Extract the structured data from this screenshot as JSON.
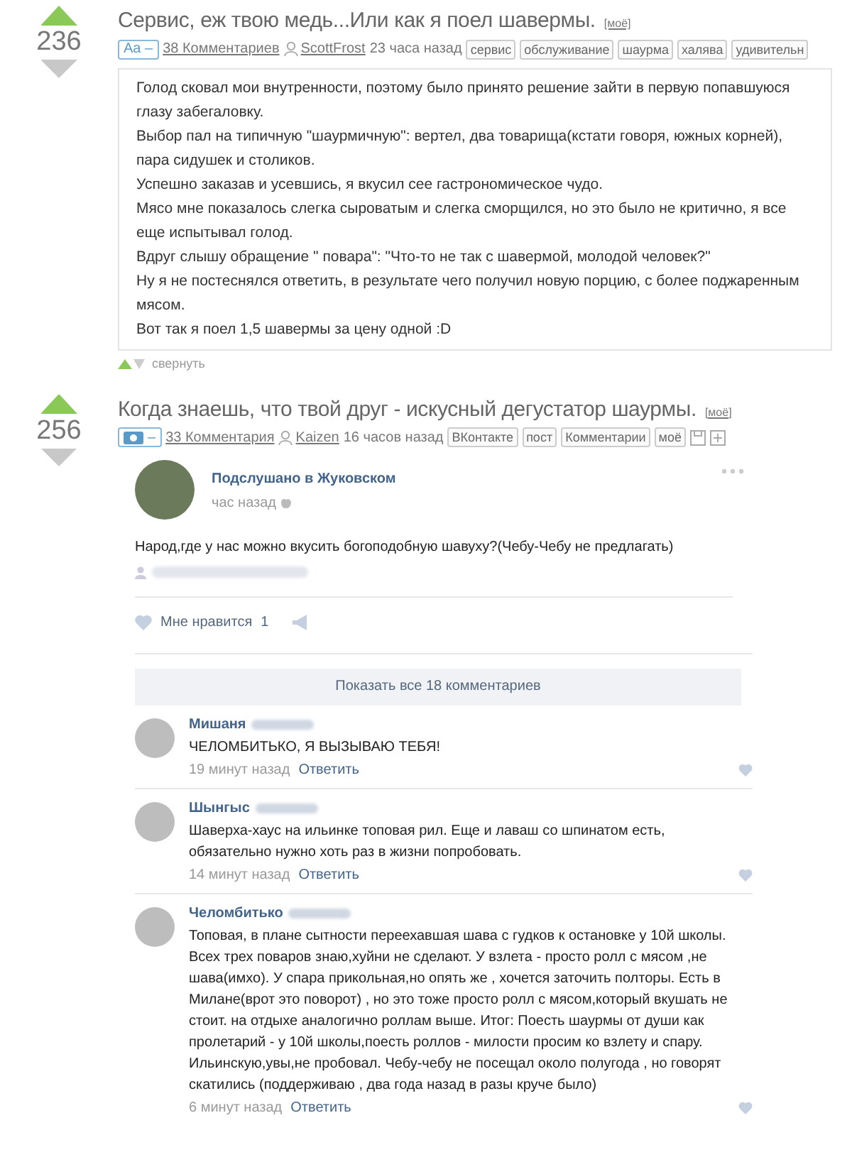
{
  "posts": [
    {
      "rating": "236",
      "title": "Сервис, еж твою медь...Или как я поел шавермы.",
      "mine": "[моё]",
      "type_badge": "Aa –",
      "comments": "38 Комментариев",
      "author": "ScottFrost",
      "time": "23 часа назад",
      "tags": [
        "сервис",
        "обслуживание",
        "шаурма",
        "халява",
        "удивительн"
      ],
      "extra_icons": false,
      "kind": "text",
      "lines": [
        "Голод сковал мои внутренности, поэтому было принято решение зайти в первую попавшуюся глазу забегаловку.",
        "Выбор пал на типичную \"шаурмичную\": вертел, два товарища(кстати говоря, южных корней), пара сидушек и столиков.",
        "Успешно заказав и усевшись, я вкусил сее гастрономическое чудо.",
        "Мясо мне показалось слегка сыроватым и слегка сморщился, но это было не критично, я все еще испытывал голод.",
        "Вдруг слышу обращение \" повара\": \"Что-то не так с шавермой, молодой человек?\"",
        "Ну я не постеснялся ответить, в результате чего получил новую порцию, с более поджаренным мясом.",
        "Вот так я поел 1,5 шавермы за цену одной :D"
      ],
      "collapse": "свернуть"
    },
    {
      "rating": "256",
      "title": "Когда знаешь, что твой друг - искусный дегустатор шаурмы.",
      "mine": "[моё]",
      "type_badge": "–",
      "comments": "33 Комментария",
      "author": "Kaizen",
      "time": "16 часов назад",
      "tags": [
        "ВКонтакте",
        "пост",
        "Комментарии",
        "моё"
      ],
      "extra_icons": true,
      "kind": "screenshot",
      "vk": {
        "group": "Подслушано в Жуковском",
        "time": "час назад",
        "text": "Народ,где у нас можно вкусить богоподобную шавуху?(Чебу-Чебу не предлагать)",
        "likes_label": "Мне нравится",
        "likes": "1",
        "show_all": "Показать все 18 комментариев",
        "comments": [
          {
            "name": "Мишаня",
            "text": "ЧЕЛОМБИТЬКО, Я ВЫЗЫВАЮ ТЕБЯ!",
            "time": "19 минут назад",
            "reply": "Ответить"
          },
          {
            "name": "Шынгыс",
            "text": "Шаверха-хаус на ильинке топовая рил. Еще и лаваш со шпинатом есть, обязательно нужно хоть раз в жизни попробовать.",
            "time": "14 минут назад",
            "reply": "Ответить"
          },
          {
            "name": "Челомбитько",
            "text": "Топовая, в плане сытности переехавшая шава с гудков к остановке у 10й школы. Всех трех поваров знаю,хуйни не сделают. У взлета - просто ролл с мясом ,не шава(имхо). У спара прикольная,но опять же , хочется заточить полторы. Есть в Милане(врот это поворот) , но это тоже просто ролл с мясом,который вкушать не стоит. на отдыхе аналогично роллам выше. Итог: Поесть шаурмы от души как пролетарий - у 10й школы,поесть роллов - милости просим ко взлету и спару. Ильинскую,увы,не пробовал. Чебу-чебу не посещал около полугода , но говорят скатились (поддерживаю , два года назад в разы круче было)",
            "time": "6 минут назад",
            "reply": "Ответить"
          }
        ]
      }
    }
  ]
}
